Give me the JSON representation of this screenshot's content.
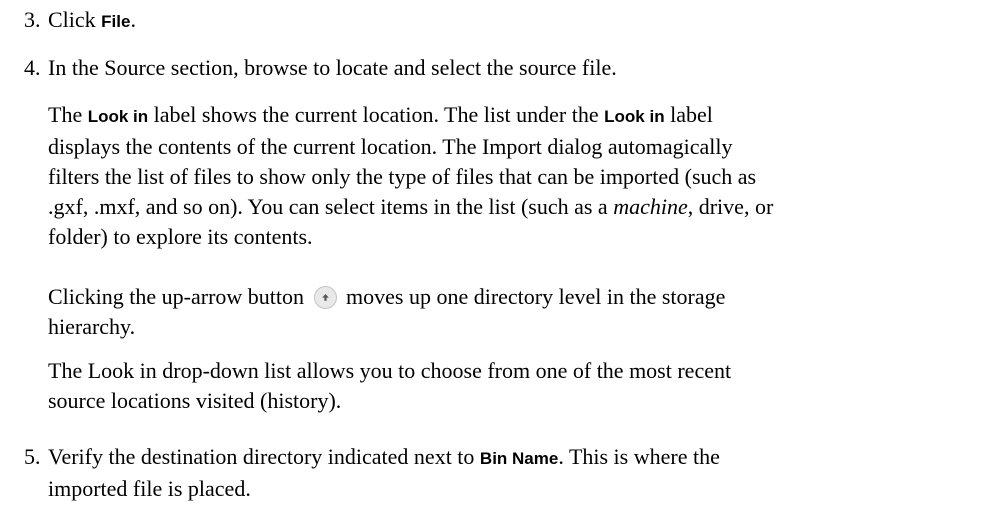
{
  "steps": [
    {
      "num": "3.",
      "pre": "Click ",
      "ui": "File",
      "post": "."
    },
    {
      "num": "4.",
      "text": "In the Source section, browse to locate and select the source file."
    },
    {
      "num": "5.",
      "pre": "Verify the destination directory indicated next to ",
      "ui": "Bin Name",
      "post": ". This is where the",
      "line2": "imported file is placed."
    }
  ],
  "para1": {
    "l1_a": "The ",
    "l1_ui1": "Look in",
    "l1_b": " label shows the current location. The list under the ",
    "l1_ui2": "Look in",
    "l1_c": " label",
    "l2": "displays the contents of the current location. The Import dialog automagically",
    "l3": "filters the list of files to show only the type of files that can be imported (such as",
    "l4_a": ".gxf, .mxf, and so on). You can select items in the list (such as a ",
    "l4_em": "machine",
    "l4_b": ", drive, or",
    "l5": "folder) to explore its contents."
  },
  "para2": {
    "l1_a": "Clicking the up-arrow button ",
    "l1_b": " moves up one directory level in the storage",
    "l2": "hierarchy.",
    "icon": "up-arrow-button-icon"
  },
  "para3": {
    "l1": "The Look in drop-down list allows you to choose from one of the most recent",
    "l2": "source locations visited (history)."
  }
}
